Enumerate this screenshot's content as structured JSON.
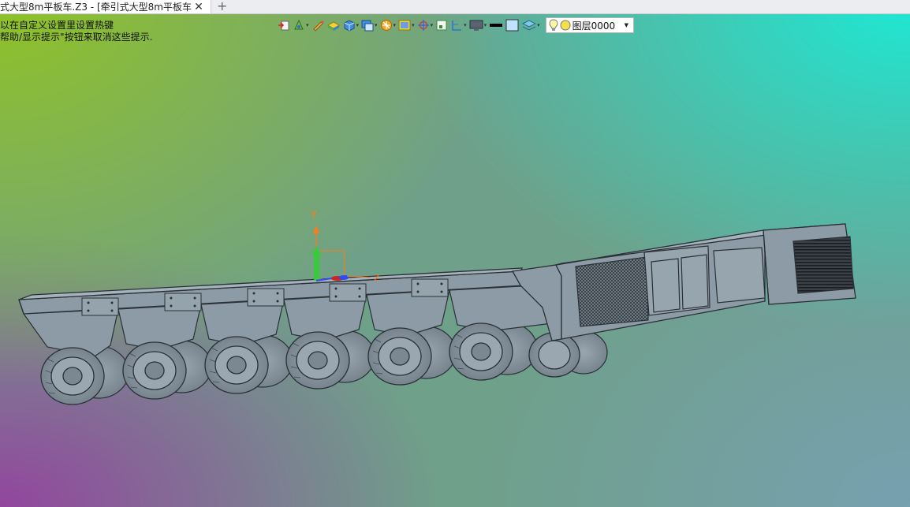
{
  "window": {
    "tab_title": "式大型8m平板车.Z3 - [牵引式大型8m平板车]",
    "close_glyph": "✕",
    "add_glyph": "+"
  },
  "hints": {
    "line1": "以在自定义设置里设置热键",
    "line2": "帮助/显示提示\"按钮来取消这些提示."
  },
  "toolbar": {
    "layer_name": "图层0000",
    "icons": [
      "exit-sketch-icon",
      "view-direction-icon",
      "sketch-pencil-icon",
      "render-mode-icon",
      "cube-view-icon",
      "display-mode-icon",
      "filter-icon",
      "background-icon",
      "snap-target-icon",
      "grid-icon",
      "dimension-icon",
      "monitor-icon",
      "line-color-icon",
      "fill-color-icon",
      "layers-icon",
      "lightbulb-icon",
      "layer-color-icon"
    ]
  },
  "triad": {
    "y_label": "Y",
    "z_label": "Z"
  },
  "colors": {
    "model_body": "#8c9ba6",
    "model_top": "#a5b3bd",
    "model_edge": "#2a3036",
    "triad_y": "#3cc83c",
    "triad_x": "#2a4cff",
    "triad_z": "#ff7a1a"
  }
}
